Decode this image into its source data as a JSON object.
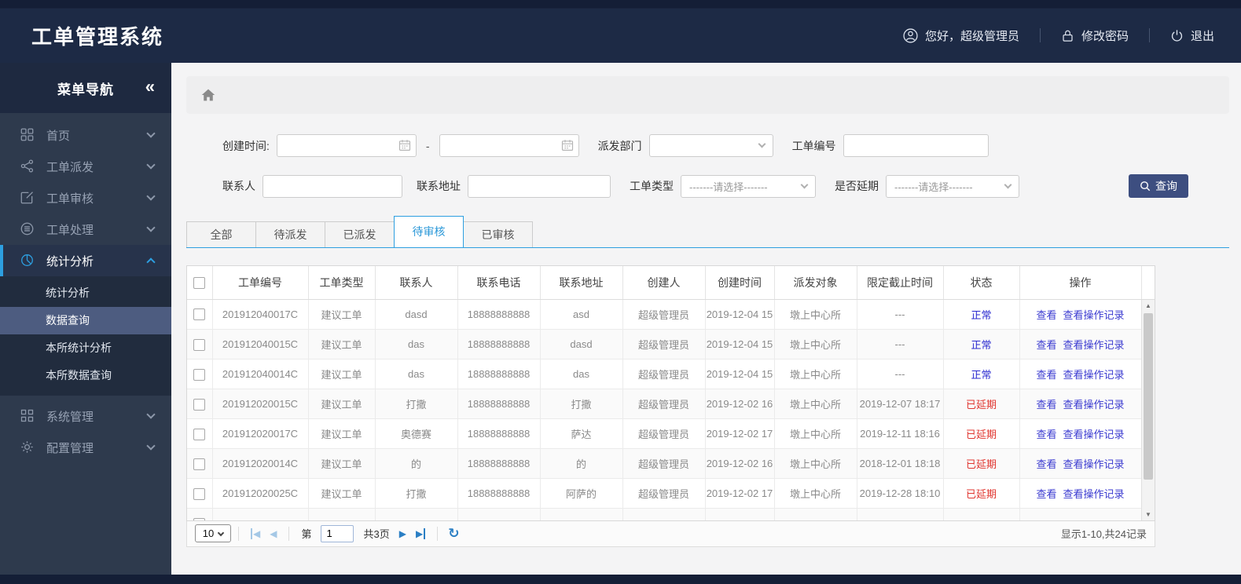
{
  "header": {
    "title": "工单管理系统",
    "greeting": "您好，超级管理员",
    "change_password": "修改密码",
    "logout": "退出"
  },
  "sidebar": {
    "title": "菜单导航",
    "collapse_icon": "«",
    "items": [
      {
        "label": "首页"
      },
      {
        "label": "工单派发"
      },
      {
        "label": "工单审核"
      },
      {
        "label": "工单处理"
      },
      {
        "label": "统计分析",
        "expanded": true,
        "children": [
          {
            "label": "统计分析"
          },
          {
            "label": "数据查询",
            "selected": true
          },
          {
            "label": "本所统计分析"
          },
          {
            "label": "本所数据查询"
          }
        ]
      },
      {
        "label": "系统管理"
      },
      {
        "label": "配置管理"
      }
    ]
  },
  "filters": {
    "create_time_label": "创建时间:",
    "date_separator": "-",
    "dispatch_dept_label": "派发部门",
    "order_no_label": "工单编号",
    "contact_label": "联系人",
    "address_label": "联系地址",
    "order_type_label": "工单类型",
    "delay_label": "是否延期",
    "select_placeholder": "-------请选择-------",
    "search_button": "查询"
  },
  "tabs": [
    {
      "label": "全部"
    },
    {
      "label": "待派发"
    },
    {
      "label": "已派发"
    },
    {
      "label": "待审核",
      "active": true
    },
    {
      "label": "已审核"
    }
  ],
  "table": {
    "headers": [
      "工单编号",
      "工单类型",
      "联系人",
      "联系电话",
      "联系地址",
      "创建人",
      "创建时间",
      "派发对象",
      "限定截止时间",
      "状态",
      "操作"
    ],
    "action_view": "查看",
    "action_log": "查看操作记录",
    "rows": [
      {
        "no": "201912040017C",
        "type": "建议工单",
        "contact": "dasd",
        "phone": "18888888888",
        "addr": "asd",
        "creator": "超级管理员",
        "created": "2019-12-04 15",
        "target": "墩上中心所",
        "deadline": "---",
        "status": "正常"
      },
      {
        "no": "201912040015C",
        "type": "建议工单",
        "contact": "das",
        "phone": "18888888888",
        "addr": "dasd",
        "creator": "超级管理员",
        "created": "2019-12-04 15",
        "target": "墩上中心所",
        "deadline": "---",
        "status": "正常"
      },
      {
        "no": "201912040014C",
        "type": "建议工单",
        "contact": "das",
        "phone": "18888888888",
        "addr": "das",
        "creator": "超级管理员",
        "created": "2019-12-04 15",
        "target": "墩上中心所",
        "deadline": "---",
        "status": "正常"
      },
      {
        "no": "201912020015C",
        "type": "建议工单",
        "contact": "打撒",
        "phone": "18888888888",
        "addr": "打撒",
        "creator": "超级管理员",
        "created": "2019-12-02 16",
        "target": "墩上中心所",
        "deadline": "2019-12-07 18:17",
        "status": "已延期"
      },
      {
        "no": "201912020017C",
        "type": "建议工单",
        "contact": "奥德赛",
        "phone": "18888888888",
        "addr": "萨达",
        "creator": "超级管理员",
        "created": "2019-12-02 17",
        "target": "墩上中心所",
        "deadline": "2019-12-11 18:16",
        "status": "已延期"
      },
      {
        "no": "201912020014C",
        "type": "建议工单",
        "contact": "的",
        "phone": "18888888888",
        "addr": "的",
        "creator": "超级管理员",
        "created": "2019-12-02 16",
        "target": "墩上中心所",
        "deadline": "2018-12-01 18:18",
        "status": "已延期"
      },
      {
        "no": "201912020025C",
        "type": "建议工单",
        "contact": "打撒",
        "phone": "18888888888",
        "addr": "阿萨的",
        "creator": "超级管理员",
        "created": "2019-12-02 17",
        "target": "墩上中心所",
        "deadline": "2019-12-28 18:10",
        "status": "已延期"
      }
    ]
  },
  "pagination": {
    "page_size": "10",
    "page_prefix": "第",
    "current_page": "1",
    "total_pages": "共3页",
    "first_icon": "◀",
    "prev_icon": "◀",
    "next_icon": "▶",
    "last_icon": "▶",
    "refresh_icon": "↻",
    "summary": "显示1-10,共24记录"
  },
  "colors": {
    "accent": "#2d9fe0",
    "link": "#3a3ad0",
    "status_normal": "#2a2ad0",
    "status_delayed": "#e0342e",
    "search_button_bg": "#3d4e80",
    "header_bg": "#1d2a45",
    "sidebar_bg": "#2e3a4d"
  }
}
